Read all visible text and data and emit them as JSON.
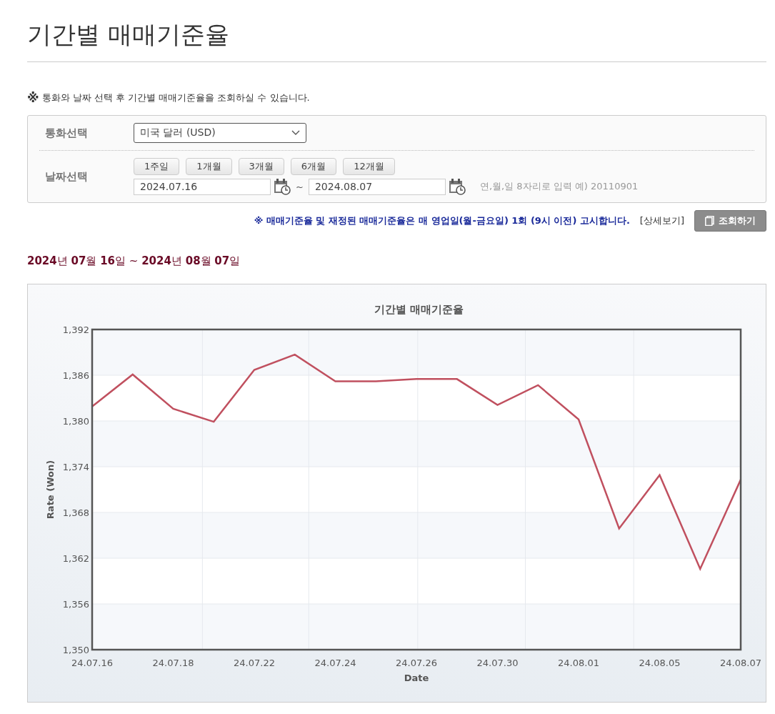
{
  "page_title": "기간별 매매기준율",
  "notice": "통화와 날짜 선택 후 기간별 매매기준율을 조회하실 수 있습니다.",
  "notice_mark": "※",
  "form": {
    "currency_label": "통화선택",
    "currency_value": "미국 달러 (USD)",
    "date_label": "날짜선택",
    "period_buttons": [
      "1주일",
      "1개월",
      "3개월",
      "6개월",
      "12개월"
    ],
    "start_date": "2024.07.16",
    "range_separator": "~",
    "end_date": "2024.08.07",
    "date_hint": "연,월,일 8자리로 입력 예) 20110901"
  },
  "info_text": "※ 매매기준율 및 재정된 매매기준율은 매 영업일(월-금요일) 1회 (9시 이전) 고시합니다.",
  "detail_link": "[상세보기]",
  "search_button": "조회하기",
  "range_heading": "**2024**년 **07**월 **16**일 ~ **2024**년 **08**월 **07**일",
  "chart": {
    "chart_data": {
      "type": "line",
      "title": "기간별 매매기준율",
      "xlabel": "Date",
      "ylabel": "Rate (Won)",
      "categories": [
        "24.07.16",
        null,
        "24.07.18",
        null,
        "24.07.22",
        null,
        "24.07.24",
        null,
        "24.07.26",
        null,
        "24.07.30",
        null,
        "24.08.01",
        null,
        "24.08.05",
        null,
        "24.08.07"
      ],
      "series": [
        {
          "color": "#c0505f",
          "values": [
            1381.9,
            1386.1,
            1381.6,
            1379.9,
            1386.7,
            1388.7,
            1385.2,
            1385.2,
            1385.5,
            1385.5,
            1382.1,
            1384.7,
            1380.2,
            1365.9,
            1372.9,
            1360.6,
            1372.3
          ]
        }
      ],
      "ylim": [
        1350,
        1392
      ],
      "grid": true,
      "yticks": [
        {
          "value": 1350,
          "label": "1,350"
        },
        {
          "value": 1356,
          "label": "1,356"
        },
        {
          "value": 1362,
          "label": "1,362"
        },
        {
          "value": 1368,
          "label": "1,368"
        },
        {
          "value": 1374,
          "label": "1,374"
        },
        {
          "value": 1380,
          "label": "1,380"
        },
        {
          "value": 1386,
          "label": "1,386"
        },
        {
          "value": 1392,
          "label": "1,392"
        }
      ]
    }
  }
}
